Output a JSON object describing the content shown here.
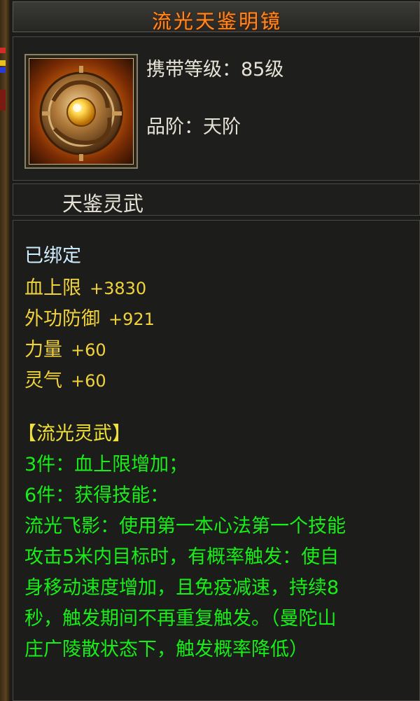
{
  "item": {
    "name": "流光天鉴明镜",
    "level_text": "携带等级：85级",
    "grade_text": "品阶：天阶",
    "category": "天鉴灵武",
    "icon": "bronze-mirror-icon"
  },
  "bound_text": "已绑定",
  "stats": [
    {
      "name": "血上限",
      "value": "+3830"
    },
    {
      "name": "外功防御",
      "value": "+921"
    },
    {
      "name": "力量",
      "value": "+60"
    },
    {
      "name": "灵气",
      "value": "+60"
    }
  ],
  "set": {
    "name": "【流光灵武】",
    "bonuses": [
      "3件：血上限增加；",
      "6件：获得技能："
    ],
    "skill_lines": [
      "流光飞影：使用第一本心法第一个技能",
      "攻击5米内目标时，有概率触发：使自",
      "身移动速度增加，且免疫减速，持续8",
      "秒，触发期间不再重复触发。（曼陀山",
      "庄广陵散状态下，触发概率降低）"
    ]
  },
  "colors": {
    "title": "#ff8a22",
    "stat": "#f0d23c",
    "set_effect": "#18ee18",
    "bound": "#cfeeff"
  }
}
